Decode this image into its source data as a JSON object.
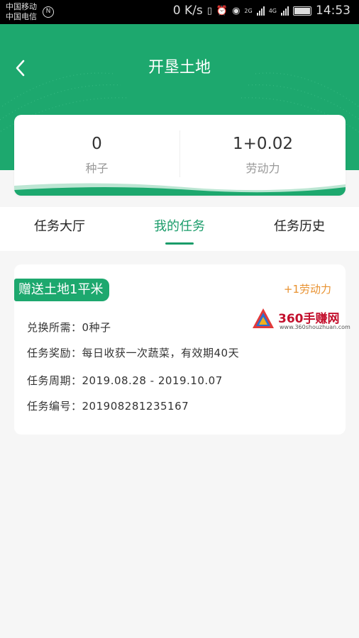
{
  "status_bar": {
    "carrier_1": "中国移动",
    "carrier_2": "中国电信",
    "speed": "0 K/s",
    "network_a": "2G",
    "network_b": "4G",
    "battery": "100",
    "time": "14:53"
  },
  "header": {
    "back_icon": "chevron-left-icon",
    "title": "开垦土地"
  },
  "stats": {
    "seeds_value": "0",
    "seeds_label": "种子",
    "labor_value": "1+0.02",
    "labor_label": "劳动力"
  },
  "tabs": [
    {
      "label": "任务大厅",
      "active": false
    },
    {
      "label": "我的任务",
      "active": true
    },
    {
      "label": "任务历史",
      "active": false
    }
  ],
  "task": {
    "badge": "赠送土地1平米",
    "reward": "+1劳动力",
    "rows": [
      {
        "label": "兑换所需：",
        "value": "0种子"
      },
      {
        "label": "任务奖励：",
        "value": "每日收获一次蔬菜，有效期40天"
      },
      {
        "label": "任务周期：",
        "value": "2019.08.28 - 2019.10.07"
      },
      {
        "label": "任务编号：",
        "value": "201908281235167"
      }
    ]
  },
  "watermark": {
    "title": "360手赚网",
    "url": "www.360shouzhuan.com"
  },
  "colors": {
    "brand_green": "#1da86e",
    "tab_active": "#1a9c6a",
    "reward_orange": "#e8912f"
  }
}
